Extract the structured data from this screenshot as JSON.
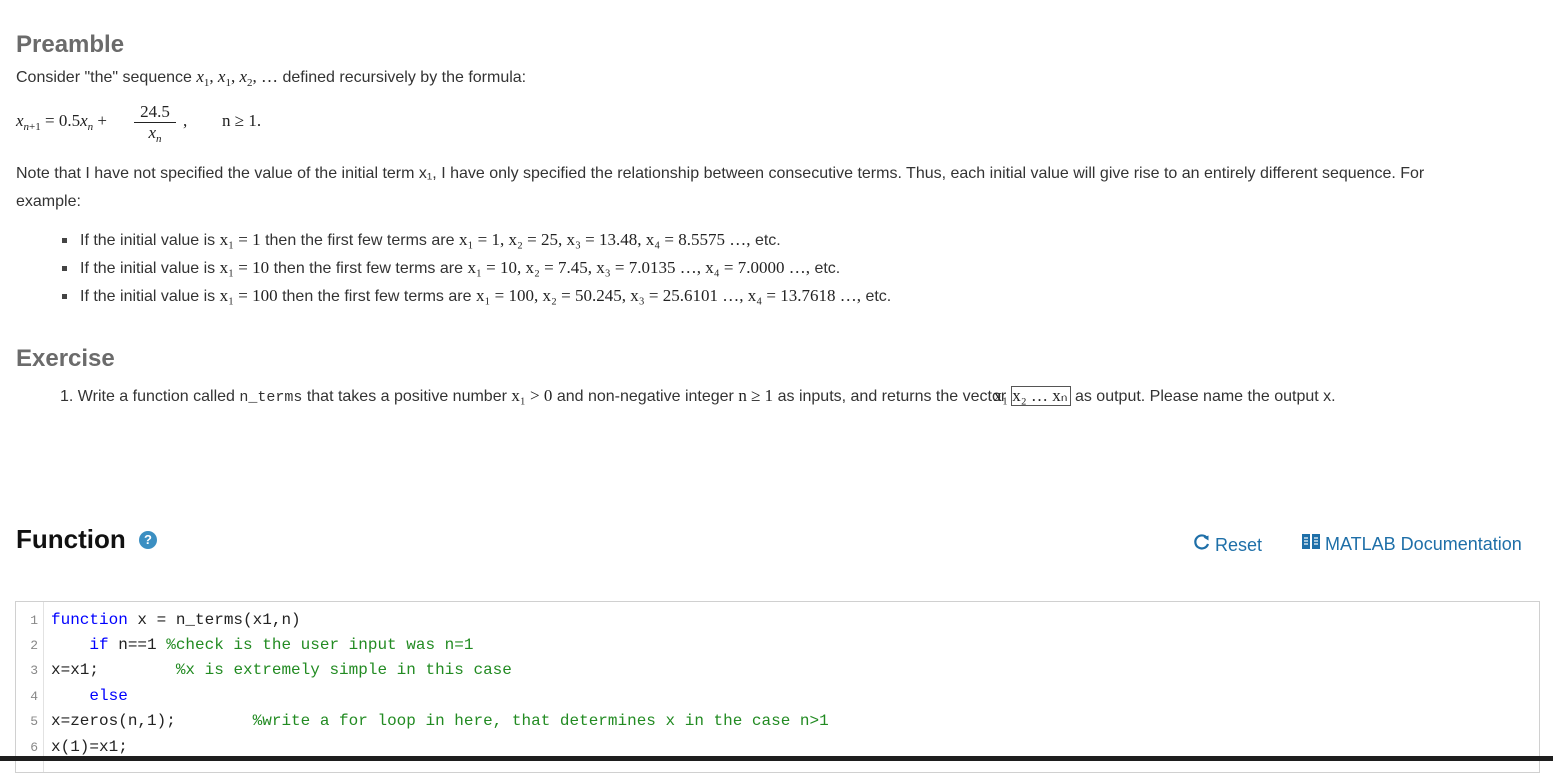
{
  "preamble": {
    "title": "Preamble",
    "intro_before": "Consider \"the\" sequence ",
    "intro_after": " defined recursively by the formula:",
    "formula": {
      "numerator": "24.5",
      "condition": "n ≥ 1."
    },
    "note": "Note that I have not specified the value of the initial term x₁, I have only specified the relationship between consecutive terms.  Thus, each initial value will give rise to an entirely different sequence.  For example:",
    "examples": [
      {
        "prefix": "If the initial value is ",
        "initial": "x₁ = 1",
        "middle": " then the first few terms are ",
        "terms": "x₁ = 1, x₂ = 25, x₃ = 13.48, x₄ = 8.5575 …,",
        "suffix": " etc."
      },
      {
        "prefix": "If the initial value is ",
        "initial": "x₁ = 10",
        "middle": " then the first few terms are ",
        "terms": "x₁ = 10, x₂ = 7.45, x₃ = 7.0135 …, x₄ = 7.0000 …,",
        "suffix": " etc."
      },
      {
        "prefix": "If the initial value is ",
        "initial": "x₁ = 100",
        "middle": " then the first few terms are ",
        "terms": "x₁ = 100, x₂ = 50.245, x₃ = 25.6101 …, x₄ = 13.7618 …,",
        "suffix": " etc."
      }
    ]
  },
  "exercise": {
    "title": "Exercise",
    "number": "1.",
    "text_1": "Write a function called ",
    "fn_name": "n_terms",
    "text_2": " that takes a positive number ",
    "math_1": "x₁ > 0",
    "text_3": " and non-negative integer ",
    "math_2": "n ≥ 1",
    "text_4": " as inputs, and returns the vector ",
    "vector": "x₁  x₂  …  xₙ",
    "text_5": " as output.  Please name the output x."
  },
  "function_panel": {
    "title": "Function",
    "help_icon": "?",
    "reset_label": "Reset",
    "doc_label": "MATLAB Documentation",
    "icons": {
      "help": "question-circle-icon",
      "reset": "refresh-icon",
      "doc": "book-icon"
    },
    "accent": "#1e6fa8"
  },
  "editor": {
    "lines": [
      {
        "n": "1",
        "kw_lead": "",
        "kw": "function",
        "rest": " x = n_terms(x1,n)",
        "comment": ""
      },
      {
        "n": "2",
        "kw_lead": "    ",
        "kw": "if",
        "rest": " n==1 ",
        "comment": "%check is the user input was n=1"
      },
      {
        "n": "3",
        "kw_lead": "",
        "kw": "",
        "rest": "x=x1;        ",
        "comment": "%x is extremely simple in this case"
      },
      {
        "n": "4",
        "kw_lead": "    ",
        "kw": "else",
        "rest": "",
        "comment": ""
      },
      {
        "n": "5",
        "kw_lead": "",
        "kw": "",
        "rest": "x=zeros(n,1);        ",
        "comment": "%write a for loop in here, that determines x in the case n>1"
      },
      {
        "n": "6",
        "kw_lead": "",
        "kw": "",
        "rest": "x(1)=x1;",
        "comment": ""
      }
    ]
  }
}
